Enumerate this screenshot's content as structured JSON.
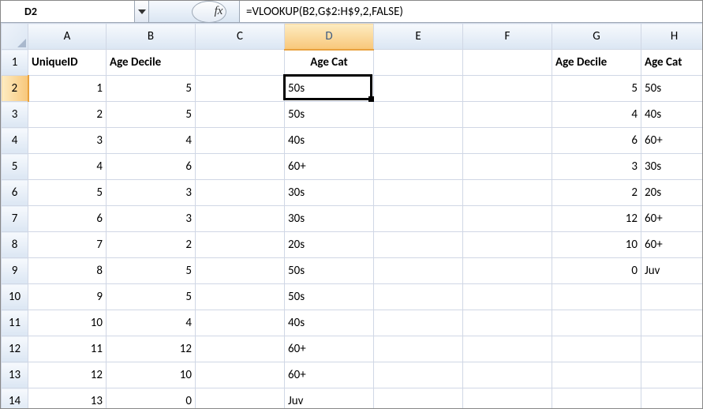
{
  "formula_bar": {
    "cell_ref": "D2",
    "formula": "=VLOOKUP(B2,G$2:H$9,2,FALSE)",
    "fx_label": "fx"
  },
  "columns": [
    "A",
    "B",
    "C",
    "D",
    "E",
    "F",
    "G",
    "H"
  ],
  "selected_column": "D",
  "selected_row": "2",
  "row_numbers": [
    "1",
    "2",
    "3",
    "4",
    "5",
    "6",
    "7",
    "8",
    "9",
    "10",
    "11",
    "12",
    "13",
    "14"
  ],
  "headers": {
    "A": "UniqueID",
    "B": "Age Decile",
    "D": "Age Cat",
    "G": "Age Decile",
    "H": "Age Cat"
  },
  "data": {
    "A": [
      "1",
      "2",
      "3",
      "4",
      "5",
      "6",
      "7",
      "8",
      "9",
      "10",
      "11",
      "12",
      "13"
    ],
    "B": [
      "5",
      "5",
      "4",
      "6",
      "3",
      "3",
      "2",
      "5",
      "5",
      "4",
      "12",
      "10",
      "0"
    ],
    "D": [
      "50s",
      "50s",
      "40s",
      "60+",
      "30s",
      "30s",
      "20s",
      "50s",
      "50s",
      "40s",
      "60+",
      "60+",
      "Juv"
    ],
    "G": [
      "5",
      "4",
      "6",
      "3",
      "2",
      "12",
      "10",
      "0",
      "",
      "",
      "",
      "",
      ""
    ],
    "H": [
      "50s",
      "40s",
      "60+",
      "30s",
      "20s",
      "60+",
      "60+",
      "Juv",
      "",
      "",
      "",
      "",
      ""
    ]
  },
  "chart_data": {
    "type": "table",
    "title": "VLOOKUP example sheet",
    "series": [
      {
        "name": "UniqueID",
        "values": [
          1,
          2,
          3,
          4,
          5,
          6,
          7,
          8,
          9,
          10,
          11,
          12,
          13
        ]
      },
      {
        "name": "Age Decile",
        "values": [
          5,
          5,
          4,
          6,
          3,
          3,
          2,
          5,
          5,
          4,
          12,
          10,
          0
        ]
      },
      {
        "name": "Age Cat",
        "values": [
          "50s",
          "50s",
          "40s",
          "60+",
          "30s",
          "30s",
          "20s",
          "50s",
          "50s",
          "40s",
          "60+",
          "60+",
          "Juv"
        ]
      }
    ],
    "lookup_table": {
      "columns": [
        "Age Decile",
        "Age Cat"
      ],
      "rows": [
        [
          5,
          "50s"
        ],
        [
          4,
          "40s"
        ],
        [
          6,
          "60+"
        ],
        [
          3,
          "30s"
        ],
        [
          2,
          "20s"
        ],
        [
          12,
          "60+"
        ],
        [
          10,
          "60+"
        ],
        [
          0,
          "Juv"
        ]
      ]
    }
  }
}
